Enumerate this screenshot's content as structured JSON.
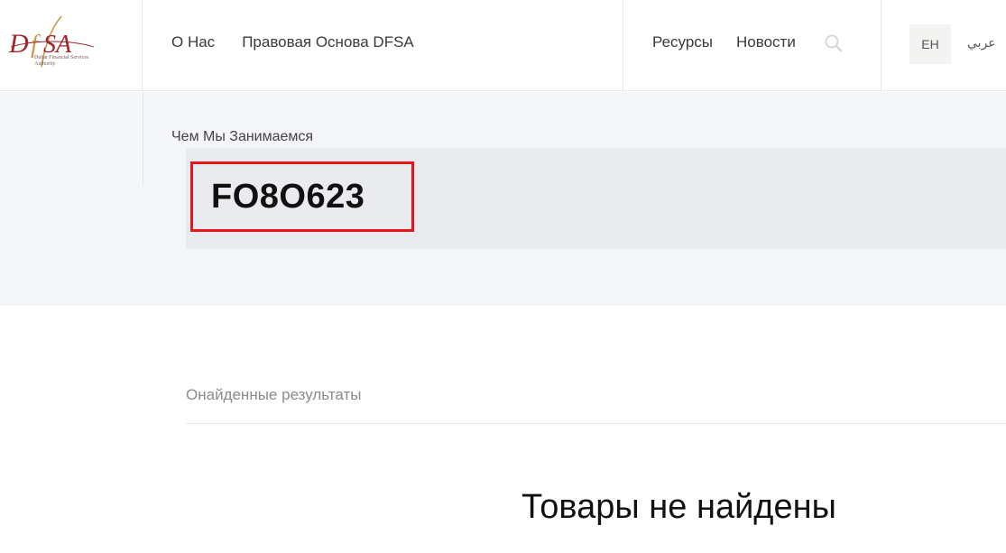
{
  "logo": {
    "wordmark": "DFSA",
    "subtitle": "Dubai Financial Services Authority",
    "colors": {
      "primary": "#a0262a",
      "accent": "#c39a4f"
    }
  },
  "nav": {
    "left": [
      {
        "label": "О Нас"
      },
      {
        "label": "Правовая Основа DFSA"
      }
    ],
    "right": [
      {
        "label": "Ресурсы"
      },
      {
        "label": "Новости"
      }
    ],
    "search_icon": "search-icon",
    "lang_en": "EH",
    "lang_ar": "عربي"
  },
  "hero": {
    "breadcrumb": "Чем Мы Занимаемся",
    "query": "FO8O623",
    "highlight_color": "#e8151b"
  },
  "results": {
    "label": "Онайденные результаты",
    "empty_message": "Товары не найдены"
  }
}
